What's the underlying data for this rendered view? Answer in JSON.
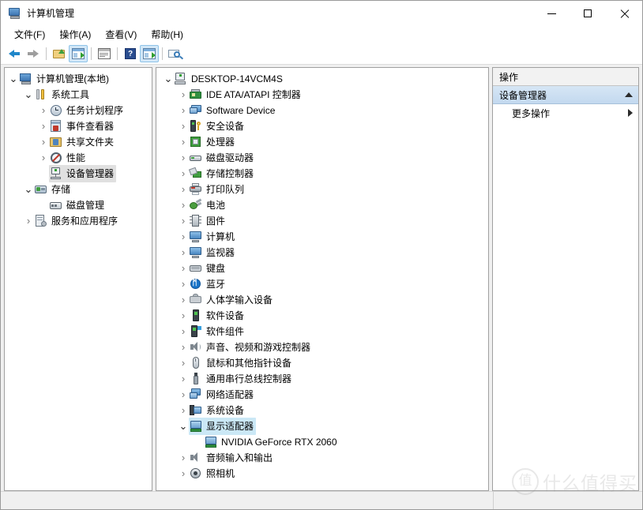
{
  "window": {
    "title": "计算机管理",
    "title_icon": "computer-management-icon",
    "controls": {
      "minimize": "最小化",
      "maximize": "最大化",
      "close": "关闭"
    }
  },
  "menubar": {
    "items": [
      {
        "label": "文件(F)",
        "name": "menu-file"
      },
      {
        "label": "操作(A)",
        "name": "menu-action"
      },
      {
        "label": "查看(V)",
        "name": "menu-view"
      },
      {
        "label": "帮助(H)",
        "name": "menu-help"
      }
    ]
  },
  "toolbar": {
    "buttons": [
      {
        "name": "back-button",
        "icon": "arrow-left-icon",
        "enabled": true
      },
      {
        "name": "forward-button",
        "icon": "arrow-right-icon",
        "enabled": false
      },
      {
        "name": "up-one-level-button",
        "icon": "folder-up-icon",
        "enabled": true
      },
      {
        "name": "show-hide-console-tree-button",
        "icon": "console-tree-icon",
        "active": true
      },
      {
        "name": "properties-button",
        "icon": "properties-icon",
        "active": false
      },
      {
        "name": "help-button",
        "icon": "help-icon",
        "label": "?"
      },
      {
        "name": "export-list-button",
        "icon": "export-list-icon",
        "active": true
      },
      {
        "name": "scan-hardware-button",
        "icon": "scan-monitor-icon",
        "active": false
      }
    ]
  },
  "console_tree": {
    "items": [
      {
        "label": "计算机管理(本地)",
        "icon": "i-cm",
        "indent": 0,
        "chev": "down",
        "name": "tree-computer-management-local"
      },
      {
        "label": "系统工具",
        "icon": "i-tools",
        "indent": 1,
        "chev": "down",
        "name": "tree-system-tools"
      },
      {
        "label": "任务计划程序",
        "icon": "i-clock",
        "indent": 2,
        "chev": "right",
        "name": "tree-task-scheduler"
      },
      {
        "label": "事件查看器",
        "icon": "i-event",
        "indent": 2,
        "chev": "right",
        "name": "tree-event-viewer"
      },
      {
        "label": "共享文件夹",
        "icon": "i-share",
        "indent": 2,
        "chev": "right",
        "name": "tree-shared-folders"
      },
      {
        "label": "性能",
        "icon": "i-perf",
        "indent": 2,
        "chev": "right",
        "name": "tree-performance"
      },
      {
        "label": "设备管理器",
        "icon": "i-devmgr",
        "indent": 2,
        "chev": "none",
        "selected": "gray",
        "name": "tree-device-manager"
      },
      {
        "label": "存储",
        "icon": "i-storage",
        "indent": 1,
        "chev": "down",
        "name": "tree-storage"
      },
      {
        "label": "磁盘管理",
        "icon": "i-disk",
        "indent": 2,
        "chev": "none",
        "name": "tree-disk-management"
      },
      {
        "label": "服务和应用程序",
        "icon": "i-svc",
        "indent": 1,
        "chev": "right",
        "name": "tree-services-and-applications"
      }
    ]
  },
  "device_tree": {
    "items": [
      {
        "label": "DESKTOP-14VCM4S",
        "icon": "i-pc",
        "indent": 0,
        "chev": "down",
        "name": "device-root-desktop"
      },
      {
        "label": "IDE ATA/ATAPI 控制器",
        "icon": "i-ide",
        "indent": 1,
        "chev": "right",
        "name": "device-ide-ata-atapi-controllers"
      },
      {
        "label": "Software Device",
        "icon": "i-mon",
        "indent": 1,
        "chev": "right",
        "name": "device-software-device"
      },
      {
        "label": "安全设备",
        "icon": "i-sec",
        "indent": 1,
        "chev": "right",
        "name": "device-security-devices"
      },
      {
        "label": "处理器",
        "icon": "i-cpu",
        "indent": 1,
        "chev": "right",
        "name": "device-processors"
      },
      {
        "label": "磁盘驱动器",
        "icon": "i-drv",
        "indent": 1,
        "chev": "right",
        "name": "device-disk-drives"
      },
      {
        "label": "存储控制器",
        "icon": "i-stc",
        "indent": 1,
        "chev": "right",
        "name": "device-storage-controllers"
      },
      {
        "label": "打印队列",
        "icon": "i-prn",
        "indent": 1,
        "chev": "right",
        "name": "device-print-queues"
      },
      {
        "label": "电池",
        "icon": "i-bat",
        "indent": 1,
        "chev": "right",
        "name": "device-batteries"
      },
      {
        "label": "固件",
        "icon": "i-fw",
        "indent": 1,
        "chev": "right",
        "name": "device-firmware"
      },
      {
        "label": "计算机",
        "icon": "i-cmp",
        "indent": 1,
        "chev": "right",
        "name": "device-computer"
      },
      {
        "label": "监视器",
        "icon": "i-cmp",
        "indent": 1,
        "chev": "right",
        "name": "device-monitors"
      },
      {
        "label": "键盘",
        "icon": "i-kbd",
        "indent": 1,
        "chev": "right",
        "name": "device-keyboards"
      },
      {
        "label": "蓝牙",
        "icon": "i-bt",
        "indent": 1,
        "chev": "right",
        "name": "device-bluetooth"
      },
      {
        "label": "人体学输入设备",
        "icon": "i-hid",
        "indent": 1,
        "chev": "right",
        "name": "device-human-interface-devices"
      },
      {
        "label": "软件设备",
        "icon": "i-sdev",
        "indent": 1,
        "chev": "right",
        "name": "device-software-devices"
      },
      {
        "label": "软件组件",
        "icon": "i-scmp",
        "indent": 1,
        "chev": "right",
        "name": "device-software-components"
      },
      {
        "label": "声音、视频和游戏控制器",
        "icon": "i-snd",
        "indent": 1,
        "chev": "right",
        "name": "device-sound-video-game-controllers"
      },
      {
        "label": "鼠标和其他指针设备",
        "icon": "i-mouse",
        "indent": 1,
        "chev": "right",
        "name": "device-mice-and-pointing-devices"
      },
      {
        "label": "通用串行总线控制器",
        "icon": "i-usb",
        "indent": 1,
        "chev": "right",
        "name": "device-usb-controllers"
      },
      {
        "label": "网络适配器",
        "icon": "i-net",
        "indent": 1,
        "chev": "right",
        "name": "device-network-adapters"
      },
      {
        "label": "系统设备",
        "icon": "i-sysd",
        "indent": 1,
        "chev": "right",
        "name": "device-system-devices"
      },
      {
        "label": "显示适配器",
        "icon": "i-disp",
        "indent": 1,
        "chev": "down",
        "selected": "blue",
        "name": "device-display-adapters"
      },
      {
        "label": "NVIDIA GeForce RTX 2060",
        "icon": "i-gpu",
        "indent": 2,
        "chev": "none",
        "name": "device-nvidia-geforce-rtx-2060"
      },
      {
        "label": "音频输入和输出",
        "icon": "i-aud",
        "indent": 1,
        "chev": "right",
        "name": "device-audio-inputs-and-outputs"
      },
      {
        "label": "照相机",
        "icon": "i-cam",
        "indent": 1,
        "chev": "right",
        "name": "device-cameras"
      }
    ]
  },
  "actions_pane": {
    "header": "操作",
    "group_title": "设备管理器",
    "group_chevron": "chevron-up-icon",
    "items": [
      {
        "label": "更多操作",
        "chevron": "chevron-right-icon",
        "name": "action-more-actions"
      }
    ]
  },
  "statusbar": {
    "left": "",
    "right": ""
  },
  "watermark": {
    "badge": "值",
    "text": "什么值得买"
  },
  "colors": {
    "selection_blue": "#cbe8f6",
    "selection_gray": "#e0e0e0",
    "action_group_bg": "#c3d9ef",
    "window_bg": "#f0f0f0",
    "pane_border": "#a0a0a0"
  }
}
